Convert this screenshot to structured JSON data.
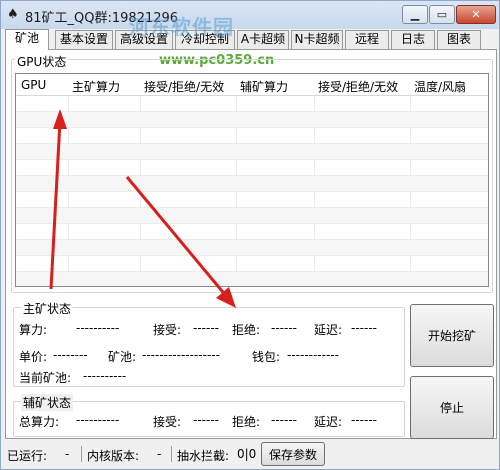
{
  "window": {
    "title": "81矿工_QQ群:19821296",
    "watermark": "河东软件园",
    "watermark_url": "www.pc0359.cn"
  },
  "tabs": [
    {
      "label": "矿池",
      "active": true
    },
    {
      "label": "基本设置",
      "active": false
    },
    {
      "label": "高级设置",
      "active": false
    },
    {
      "label": "冷却控制",
      "active": false
    },
    {
      "label": "A卡超频",
      "active": false
    },
    {
      "label": "N卡超频",
      "active": false
    },
    {
      "label": "远程",
      "active": false
    },
    {
      "label": "日志",
      "active": false
    },
    {
      "label": "图表",
      "active": false
    }
  ],
  "gpu_status": {
    "group_label": "GPU状态",
    "columns": [
      "GPU",
      "主矿算力",
      "接受/拒绝/无效",
      "辅矿算力",
      "接受/拒绝/无效",
      "温度/风扇"
    ]
  },
  "main_mining": {
    "group_label": "主矿状态",
    "hashrate_label": "算力:",
    "hashrate_value": "----------",
    "accepted_label": "接受:",
    "accepted_value": "------",
    "rejected_label": "拒绝:",
    "rejected_value": "------",
    "latency_label": "延迟:",
    "latency_value": "------",
    "price_label": "单价:",
    "price_value": "--------",
    "pool_label": "矿池:",
    "pool_value": "------------------",
    "wallet_label": "钱包:",
    "wallet_value": "------------",
    "current_pool_label": "当前矿池:",
    "current_pool_value": "----------"
  },
  "dual_mining": {
    "group_label": "辅矿状态",
    "hashrate_label": "总算力:",
    "hashrate_value": "----------",
    "accepted_label": "接受:",
    "accepted_value": "------",
    "rejected_label": "拒绝:",
    "rejected_value": "------",
    "latency_label": "延迟:",
    "latency_value": "------"
  },
  "buttons": {
    "start": "开始挖矿",
    "stop": "停止",
    "save": "保存参数"
  },
  "status_bar": {
    "running_label": "已运行:",
    "running_value": "-",
    "kernel_label": "内核版本:",
    "kernel_value": "-",
    "intercept_label": "抽水拦截:",
    "intercept_value": "0|0"
  },
  "colors": {
    "arrow": "#d7201b",
    "close_button": "#c7472e"
  }
}
